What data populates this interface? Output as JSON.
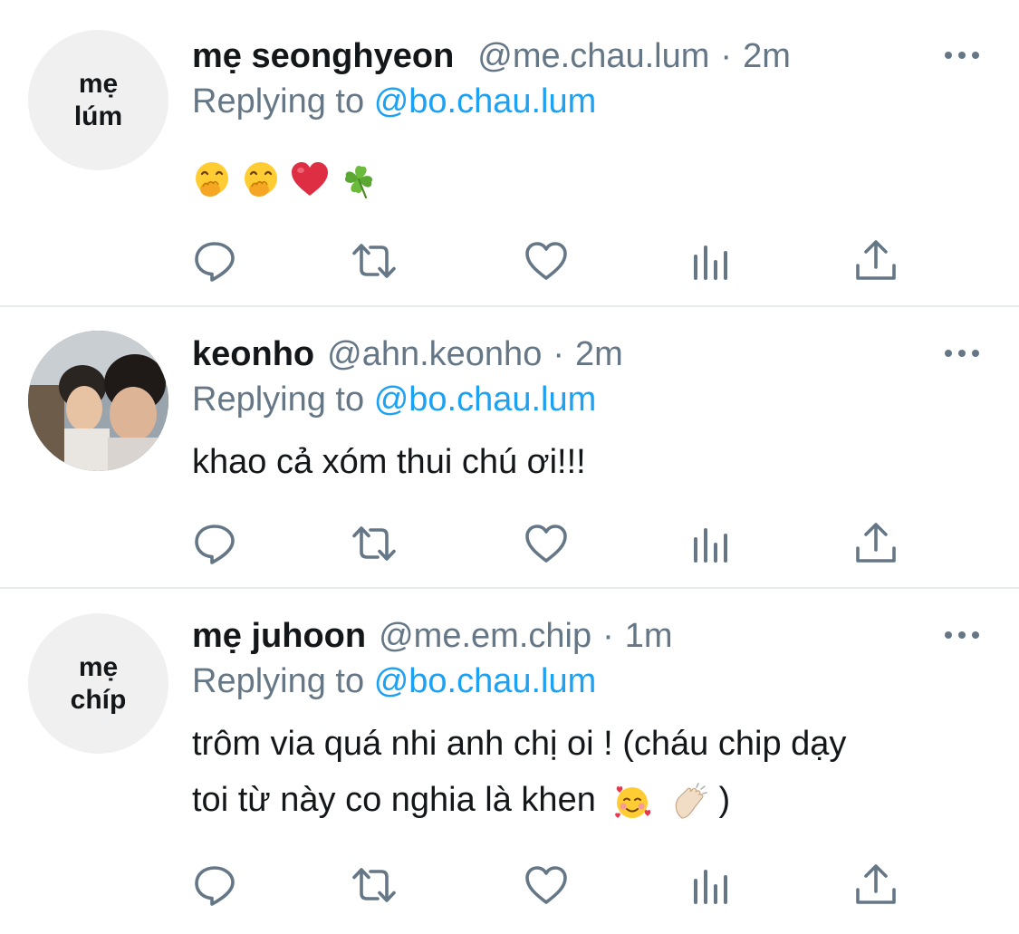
{
  "tweets": [
    {
      "avatar_text": [
        "mẹ",
        "lúm"
      ],
      "name": "mẹ seonghyeon",
      "handle": "@me.chau.lum",
      "dot": "·",
      "time": "2m",
      "replying_prefix": "Replying to",
      "replying_handle": "@bo.chau.lum",
      "body_emojis": [
        "face-with-hand-over-mouth",
        "face-with-hand-over-mouth",
        "red-heart",
        "four-leaf-clover"
      ]
    },
    {
      "avatar_desc": "photo-avatar",
      "name": "keonho",
      "handle": "@ahn.keonho",
      "dot": "·",
      "time": "2m",
      "replying_prefix": "Replying to",
      "replying_handle": "@bo.chau.lum",
      "body": "khao cả xóm thui chú ơi!!!"
    },
    {
      "avatar_text": [
        "mẹ",
        "chíp"
      ],
      "name": "mẹ juhoon",
      "handle": "@me.em.chip",
      "dot": "·",
      "time": "1m",
      "replying_prefix": "Replying to",
      "replying_handle": "@bo.chau.lum",
      "body_line1": "trôm via quá nhi anh chị oi ! (cháu chip dạy",
      "body_line2_text": "toi từ này co nghia là khen",
      "body_line2_end": ")",
      "body_line2_emojis": [
        "smiling-face-with-hearts",
        "clapping-hands"
      ]
    }
  ],
  "colors": {
    "text": "#14171a",
    "secondary": "#657786",
    "mention": "#1da1f2",
    "divider": "#e6ecf0",
    "avatar_bg": "#f0f0f0"
  },
  "icons": [
    "more-icon",
    "reply-icon",
    "retweet-icon",
    "like-icon",
    "views-icon",
    "share-icon"
  ]
}
